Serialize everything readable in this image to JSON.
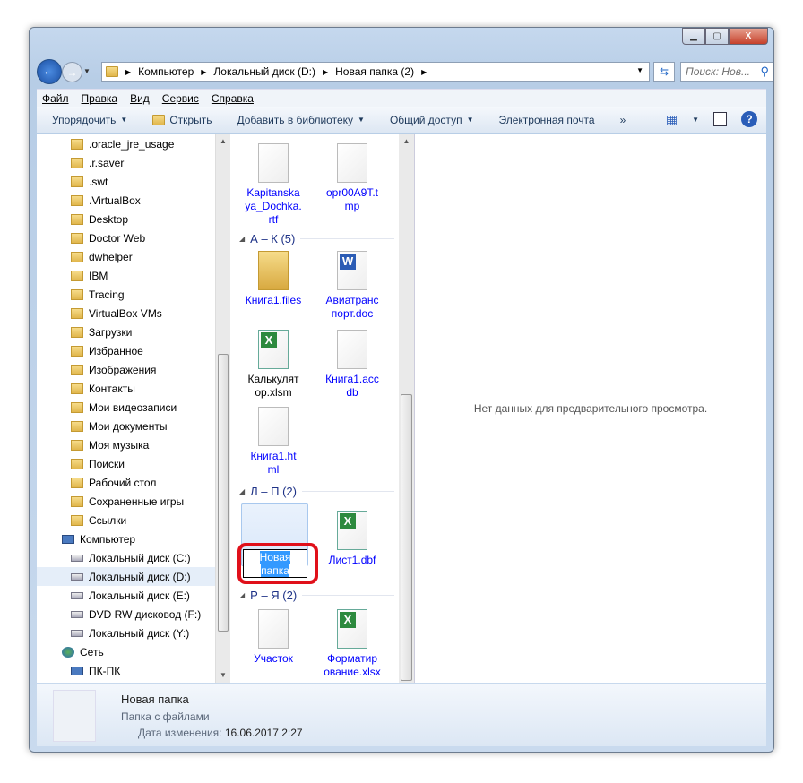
{
  "window": {
    "controls": [
      "minimize",
      "maximize",
      "close"
    ]
  },
  "address": {
    "crumbs": [
      "Компьютер",
      "Локальный диск (D:)",
      "Новая папка (2)"
    ]
  },
  "search": {
    "placeholder": "Поиск: Нов..."
  },
  "menu": [
    "Файл",
    "Правка",
    "Вид",
    "Сервис",
    "Справка"
  ],
  "toolbar": {
    "organize": "Упорядочить",
    "open": "Открыть",
    "library": "Добавить в библиотеку",
    "share": "Общий доступ",
    "email": "Электронная почта",
    "more": "»"
  },
  "tree": [
    {
      "label": ".oracle_jre_usage",
      "icon": "f",
      "indent": 1
    },
    {
      "label": ".r.saver",
      "icon": "f",
      "indent": 1
    },
    {
      "label": ".swt",
      "icon": "f",
      "indent": 1
    },
    {
      "label": ".VirtualBox",
      "icon": "f",
      "indent": 1
    },
    {
      "label": "Desktop",
      "icon": "f",
      "indent": 1
    },
    {
      "label": "Doctor Web",
      "icon": "f",
      "indent": 1
    },
    {
      "label": "dwhelper",
      "icon": "f",
      "indent": 1
    },
    {
      "label": "IBM",
      "icon": "f",
      "indent": 1
    },
    {
      "label": "Tracing",
      "icon": "f",
      "indent": 1
    },
    {
      "label": "VirtualBox VMs",
      "icon": "f",
      "indent": 1
    },
    {
      "label": "Загрузки",
      "icon": "f",
      "indent": 1
    },
    {
      "label": "Избранное",
      "icon": "f",
      "indent": 1
    },
    {
      "label": "Изображения",
      "icon": "f",
      "indent": 1
    },
    {
      "label": "Контакты",
      "icon": "f",
      "indent": 1
    },
    {
      "label": "Мои видеозаписи",
      "icon": "f",
      "indent": 1
    },
    {
      "label": "Мои документы",
      "icon": "f",
      "indent": 1
    },
    {
      "label": "Моя музыка",
      "icon": "f",
      "indent": 1
    },
    {
      "label": "Поиски",
      "icon": "f",
      "indent": 1
    },
    {
      "label": "Рабочий стол",
      "icon": "f",
      "indent": 1
    },
    {
      "label": "Сохраненные игры",
      "icon": "f",
      "indent": 1
    },
    {
      "label": "Ссылки",
      "icon": "f",
      "indent": 1
    },
    {
      "label": "Компьютер",
      "icon": "c",
      "indent": 0
    },
    {
      "label": "Локальный диск (C:)",
      "icon": "d",
      "indent": 1
    },
    {
      "label": "Локальный диск (D:)",
      "icon": "d",
      "indent": 1,
      "selected": true
    },
    {
      "label": "Локальный диск (E:)",
      "icon": "d",
      "indent": 1
    },
    {
      "label": "DVD RW дисковод (F:)",
      "icon": "d",
      "indent": 1
    },
    {
      "label": "Локальный диск (Y:)",
      "icon": "d",
      "indent": 1
    },
    {
      "label": "Сеть",
      "icon": "n",
      "indent": 0
    },
    {
      "label": "ПК-ПК",
      "icon": "c",
      "indent": 1
    }
  ],
  "groups": [
    "А – К (5)",
    "Л – П (2)",
    "Р – Я (2)"
  ],
  "files": [
    {
      "lines": [
        "Kapitanska",
        "ya_Dochka.",
        "rtf"
      ],
      "icon": "doc"
    },
    {
      "lines": [
        "opr00A9T.t",
        "mp"
      ],
      "icon": "doc"
    },
    {
      "lines": [
        "Книга1.files"
      ],
      "icon": "fold"
    },
    {
      "lines": [
        "Авиатранс",
        "порт.doc"
      ],
      "icon": "w"
    },
    {
      "lines": [
        "Калькулят",
        "ор.xlsm"
      ],
      "icon": "xl",
      "color": "#000000"
    },
    {
      "lines": [
        "Книга1.acc",
        "db"
      ],
      "icon": "doc"
    },
    {
      "lines": [
        "Книга1.ht",
        "ml"
      ],
      "icon": "doc"
    },
    {
      "lines": [
        "Лист1.dbf"
      ],
      "icon": "xl"
    },
    {
      "lines": [
        "Участок"
      ],
      "icon": "doc"
    },
    {
      "lines": [
        "Форматир",
        "ование.xlsx"
      ],
      "icon": "xl"
    }
  ],
  "rename": {
    "line1": "Новая",
    "line2": "папка"
  },
  "preview": {
    "text": "Нет данных для предварительного просмотра."
  },
  "status": {
    "name": "Новая папка",
    "type": "Папка с файлами",
    "date_label": "Дата изменения:",
    "date": "16.06.2017 2:27"
  }
}
